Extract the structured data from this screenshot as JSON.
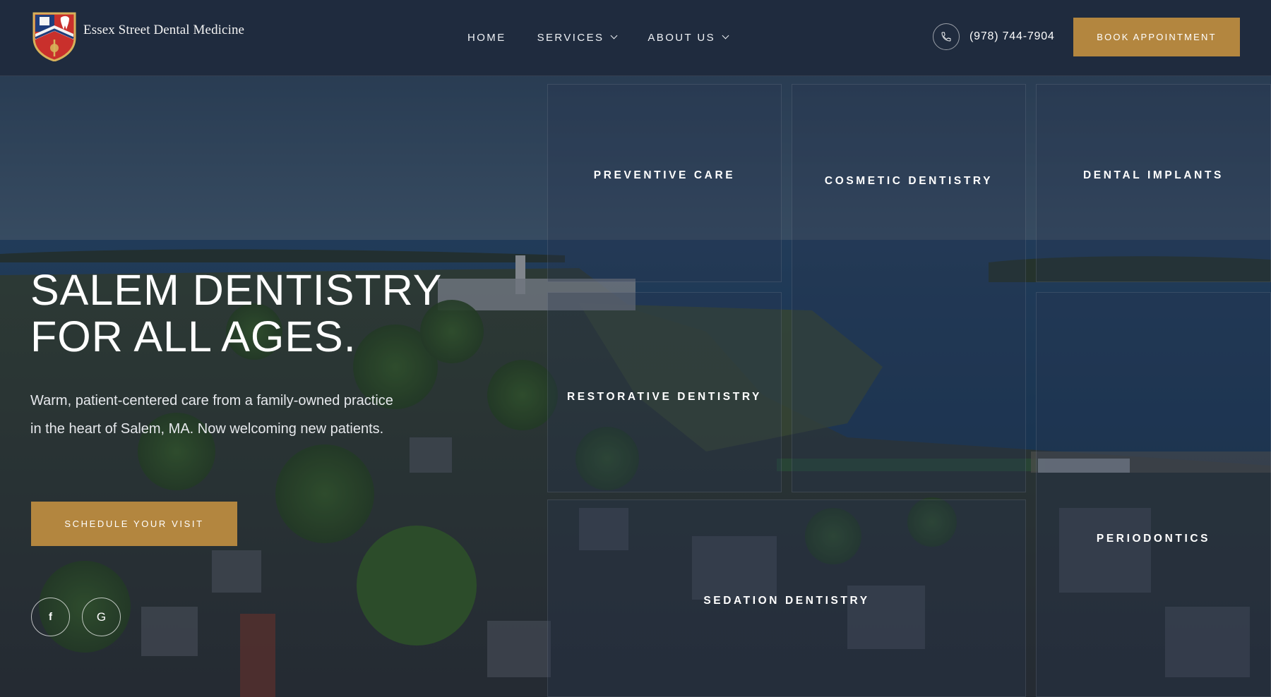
{
  "brand": {
    "name": "Essex Street Dental Medicine",
    "logo_icon": "crest-shield",
    "accent": "#b3863f",
    "header_bg": "#1f2b3e"
  },
  "nav": {
    "items": [
      {
        "label": "HOME",
        "has_dropdown": false
      },
      {
        "label": "SERVICES",
        "has_dropdown": true
      },
      {
        "label": "ABOUT US",
        "has_dropdown": true
      }
    ]
  },
  "header": {
    "phone_icon": "phone-icon",
    "phone": "(978) 744-7904",
    "book_label": "BOOK APPOINTMENT"
  },
  "hero": {
    "title_line1": "SALEM DENTISTRY",
    "title_line2": "FOR ALL AGES.",
    "subtitle": "Warm, patient-centered care from a family-owned practice in the heart of Salem, MA. Now welcoming new patients.",
    "cta_label": "SCHEDULE YOUR VISIT",
    "background": "aerial-photo-salem-harbor"
  },
  "social": [
    {
      "icon": "facebook-icon",
      "glyph": "f"
    },
    {
      "icon": "google-icon",
      "glyph": "G"
    }
  ],
  "services": {
    "preventive": "PREVENTIVE CARE",
    "cosmetic": "COSMETIC DENTISTRY",
    "implants": "DENTAL IMPLANTS",
    "restorative": "RESTORATIVE DENTISTRY",
    "periodontics": "PERIODONTICS",
    "sedation": "SEDATION DENTISTRY"
  }
}
